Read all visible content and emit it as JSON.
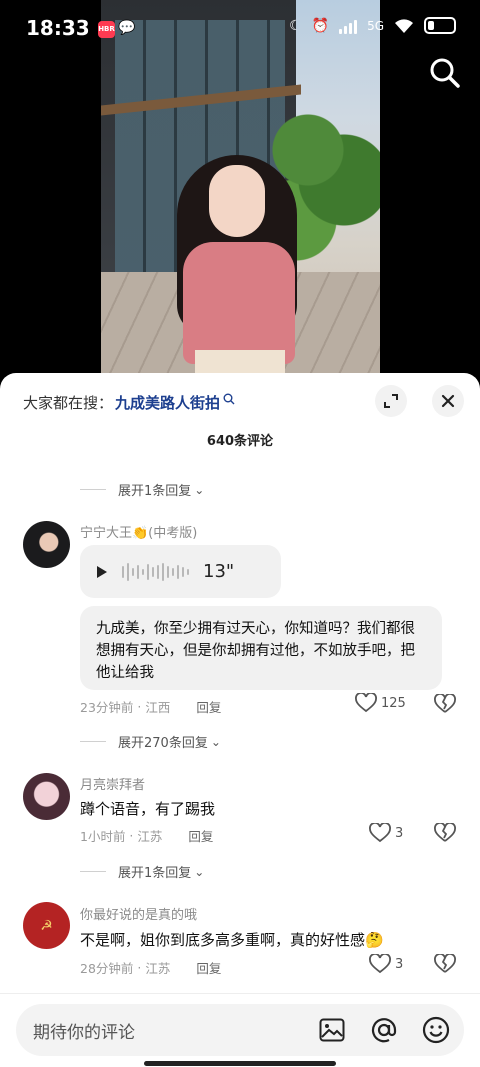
{
  "status_bar": {
    "time": "18:33",
    "app_badge": "HBR",
    "network": "5G"
  },
  "hot_search": {
    "prefix": "大家都在搜：",
    "keyword": "九成美路人街拍"
  },
  "comment_count": "640条评论",
  "expand_top": "展开1条回复",
  "comments": [
    {
      "username": "宁宁大王👏(中考版)",
      "voice_duration": "13\"",
      "text": "九成美，你至少拥有过天心，你知道吗？我们都很想拥有天心，但是你却拥有过他，不如放手吧，把他让给我",
      "time": "23分钟前",
      "location": "江西",
      "reply": "回复",
      "likes": "125",
      "expand": "展开270条回复"
    },
    {
      "username": "月亮崇拜者",
      "text": "蹲个语音，有了踢我",
      "time": "1小时前",
      "location": "江苏",
      "reply": "回复",
      "likes": "3",
      "expand": "展开1条回复"
    },
    {
      "username": "你最好说的是真的哦",
      "text": "不是啊，姐你到底多高多重啊，真的好性感🤔",
      "time": "28分钟前",
      "location": "江苏",
      "reply": "回复",
      "likes": "3"
    }
  ],
  "input": {
    "placeholder": "期待你的评论"
  },
  "colors": {
    "keyword": "#1d3f8f",
    "sheet_bg": "#ffffff"
  }
}
